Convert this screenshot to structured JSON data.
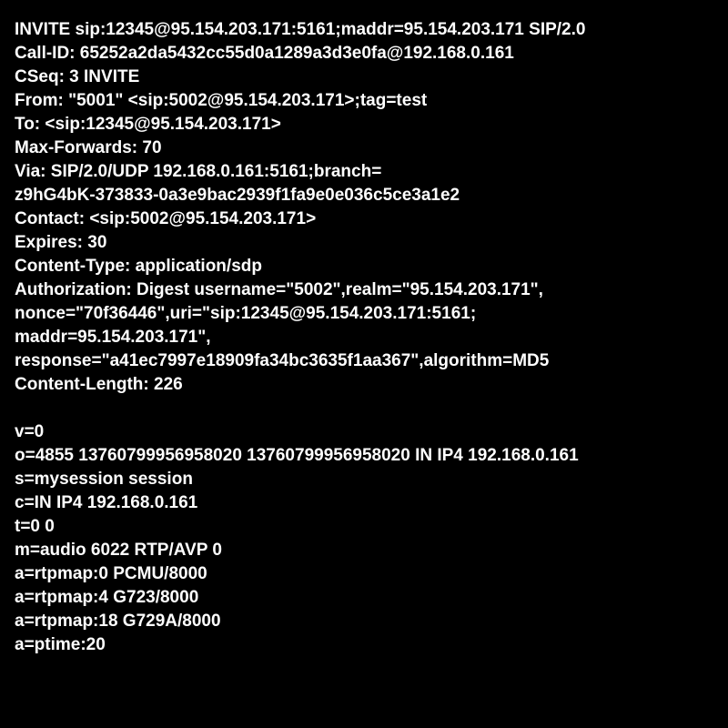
{
  "header_lines": [
    "INVITE sip:12345@95.154.203.171:5161;maddr=95.154.203.171 SIP/2.0",
    "Call-ID: 65252a2da5432cc55d0a1289a3d3e0fa@192.168.0.161",
    "CSeq: 3 INVITE",
    "From: \"5001\" <sip:5002@95.154.203.171>;tag=test",
    "To: <sip:12345@95.154.203.171>",
    "Max-Forwards: 70",
    "Via: SIP/2.0/UDP 192.168.0.161:5161;branch=",
    "z9hG4bK-373833-0a3e9bac2939f1fa9e0e036c5ce3a1e2",
    "Contact: <sip:5002@95.154.203.171>",
    "Expires: 30",
    "Content-Type: application/sdp",
    "Authorization: Digest username=\"5002\",realm=\"95.154.203.171\",",
    "nonce=\"70f36446\",uri=\"sip:12345@95.154.203.171:5161;",
    "maddr=95.154.203.171\",",
    "response=\"a41ec7997e18909fa34bc3635f1aa367\",algorithm=MD5",
    "Content-Length: 226"
  ],
  "sdp_lines": [
    "v=0",
    "o=4855 13760799956958020 13760799956958020 IN IP4 192.168.0.161",
    "s=mysession session",
    "c=IN IP4 192.168.0.161",
    "t=0 0",
    "m=audio 6022 RTP/AVP 0",
    "a=rtpmap:0 PCMU/8000",
    "a=rtpmap:4 G723/8000",
    "a=rtpmap:18 G729A/8000",
    "a=ptime:20"
  ]
}
